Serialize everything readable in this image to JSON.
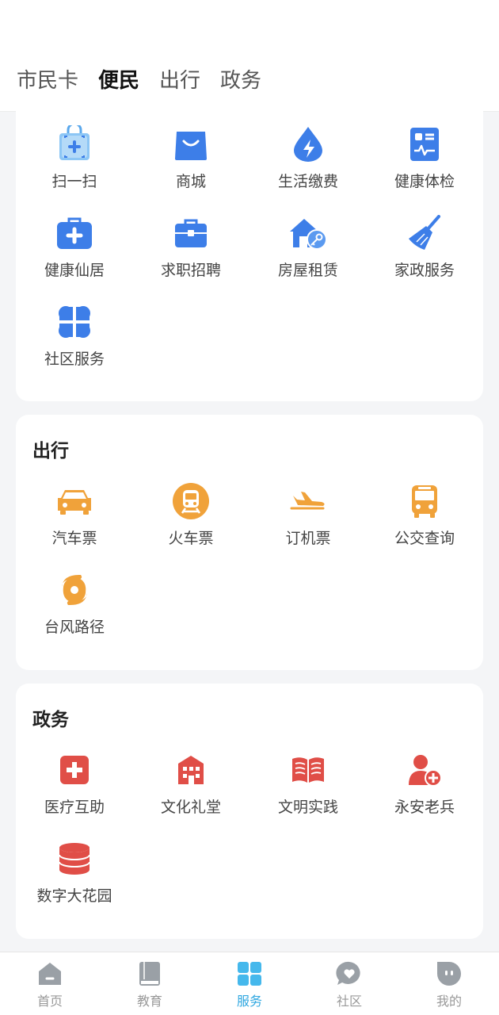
{
  "header": {
    "tabs": [
      {
        "label": "市民卡",
        "active": false
      },
      {
        "label": "便民",
        "active": true
      },
      {
        "label": "出行",
        "active": false
      },
      {
        "label": "政务",
        "active": false
      }
    ]
  },
  "colors": {
    "blue_icon": "#3d7ee8",
    "orange_icon": "#f0a23a",
    "red_icon": "#e04e47",
    "tab_indicator": "#1aa1e6",
    "active_nav": "#2fa7e0",
    "inactive_nav": "#9aa0a6"
  },
  "sections": {
    "bianmin": {
      "items": [
        {
          "label": "扫一扫",
          "icon": "scan-bag-icon"
        },
        {
          "label": "商城",
          "icon": "shopping-bag-icon"
        },
        {
          "label": "生活缴费",
          "icon": "utility-drop-icon"
        },
        {
          "label": "健康体检",
          "icon": "health-report-icon"
        },
        {
          "label": "健康仙居",
          "icon": "medical-kit-icon"
        },
        {
          "label": "求职招聘",
          "icon": "briefcase-icon"
        },
        {
          "label": "房屋租赁",
          "icon": "house-key-icon"
        },
        {
          "label": "家政服务",
          "icon": "broom-icon"
        },
        {
          "label": "社区服务",
          "icon": "community-grid-icon"
        }
      ]
    },
    "chuxing": {
      "title": "出行",
      "items": [
        {
          "label": "汽车票",
          "icon": "car-icon"
        },
        {
          "label": "火车票",
          "icon": "train-icon"
        },
        {
          "label": "订机票",
          "icon": "airplane-icon"
        },
        {
          "label": "公交查询",
          "icon": "bus-icon"
        },
        {
          "label": "台风路径",
          "icon": "typhoon-icon"
        }
      ]
    },
    "zhengwu": {
      "title": "政务",
      "items": [
        {
          "label": "医疗互助",
          "icon": "medical-cross-icon"
        },
        {
          "label": "文化礼堂",
          "icon": "hall-building-icon"
        },
        {
          "label": "文明实践",
          "icon": "open-book-icon"
        },
        {
          "label": "永安老兵",
          "icon": "veteran-user-icon"
        },
        {
          "label": "数字大花园",
          "icon": "database-icon"
        }
      ]
    }
  },
  "bottom_nav": [
    {
      "label": "首页",
      "icon": "home-icon",
      "active": false
    },
    {
      "label": "教育",
      "icon": "book-icon",
      "active": false
    },
    {
      "label": "服务",
      "icon": "grid-icon",
      "active": true
    },
    {
      "label": "社区",
      "icon": "heart-chat-icon",
      "active": false
    },
    {
      "label": "我的",
      "icon": "profile-icon",
      "active": false
    }
  ]
}
